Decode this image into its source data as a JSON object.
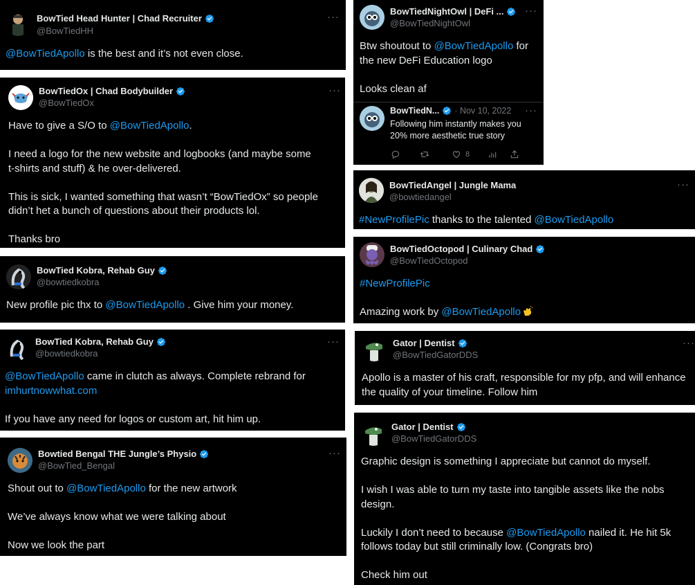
{
  "colors": {
    "background": "#000000",
    "text": "#e7e9ea",
    "muted": "#71767b",
    "link": "#1d9bf0",
    "verified": "#1d9bf0"
  },
  "more_label": "···",
  "tweets": [
    {
      "name": "BowTied Head Hunter | Chad Recruiter",
      "handle": "@BowTiedHH",
      "mention": "@BowTiedApollo",
      "text": " is the best and it’s not even close.",
      "avatar_icon": "recruiter-avatar-icon"
    },
    {
      "name": "BowTiedOx | Chad Bodybuilder",
      "handle": "@BowTiedOx",
      "line1_pre": "Have to give a S/O to ",
      "line1_mention": "@BowTiedApollo",
      "line1_post": ".",
      "p2a": "I need a logo for the new website and logbooks (and maybe some",
      "p2b": "t-shirts and stuff) & he over-delivered.",
      "p3a": "This is sick, I wanted something that wasn’t “BowTiedOx” so people",
      "p3b": "didn’t het a bunch of questions about their products lol.",
      "p4": "Thanks bro",
      "avatar_icon": "ox-avatar-icon"
    },
    {
      "name": "BowTied Kobra, Rehab Guy",
      "handle": "@bowtiedkobra",
      "pre": "New profile pic thx to ",
      "mention": "@BowTiedApollo",
      "post": " . Give him your money.",
      "avatar_icon": "kobra-avatar-icon"
    },
    {
      "name": "BowTied Kobra, Rehab Guy",
      "handle": "@bowtiedkobra",
      "mention": "@BowTiedApollo",
      "l1": " came in clutch as always. Complete rebrand for",
      "link": "imhurtnowwhat.com",
      "p2": "If you have any need for logos or custom art, hit him up.",
      "avatar_icon": "kobra-avatar-icon"
    },
    {
      "name": "Bowtied Bengal THE Jungle’s Physio",
      "handle": "@BowTied_Bengal",
      "pre": "Shout out to ",
      "mention": "@BowTiedApollo",
      "post": " for the new artwork",
      "p2": "We’ve always know what we were talking about",
      "p3": "Now we look the part",
      "avatar_icon": "bengal-avatar-icon"
    },
    {
      "name": "BowTiedNightOwl | DeFi ...",
      "handle": "@BowTiedNightOwl",
      "pre": "Btw shoutout to ",
      "mention": "@BowTiedApollo",
      "post": " for",
      "l2": "the new DeFi Education logo",
      "p2": "Looks clean af",
      "avatar_icon": "owl-avatar-icon",
      "quote": {
        "name": "BowTiedN...",
        "date": "· Nov 10, 2022",
        "l1": "Following him instantly makes you",
        "l2": "20% more aesthetic true story",
        "likes": "8"
      }
    },
    {
      "name": "BowTiedAngel | Jungle Mama",
      "handle": "@bowtiedangel",
      "hashtag": "#NewProfilePic",
      "mid": " thanks to the talented ",
      "mention": "@BowTiedApollo",
      "avatar_icon": "angel-avatar-icon"
    },
    {
      "name": "BowTiedOctopod | Culinary Chad",
      "handle": "@BowTiedOctopod",
      "hashtag": "#NewProfilePic",
      "pre": "Amazing work by ",
      "mention": "@BowTiedApollo",
      "avatar_icon": "octopod-avatar-icon"
    },
    {
      "name": "Gator | Dentist",
      "handle": "@BowTiedGatorDDS",
      "l1": "Apollo is a master of his craft, responsible for my pfp, and will enhance",
      "l2": "the quality of your timeline. Follow him",
      "avatar_icon": "gator-avatar-icon"
    },
    {
      "name": "Gator | Dentist",
      "handle": "@BowTiedGatorDDS",
      "p1": "Graphic design is something I appreciate but cannot do myself.",
      "p2a": "I wish I was able to turn my taste into tangible assets like the nobs",
      "p2b": "design.",
      "p3_pre": "Luckily I don’t need to because ",
      "mention": "@BowTiedApollo",
      "p3_post": " nailed it. He hit 5k",
      "p3b": "follows today but still criminally low. (Congrats bro)",
      "p4": "Check him out",
      "avatar_icon": "gator-avatar-icon"
    }
  ]
}
